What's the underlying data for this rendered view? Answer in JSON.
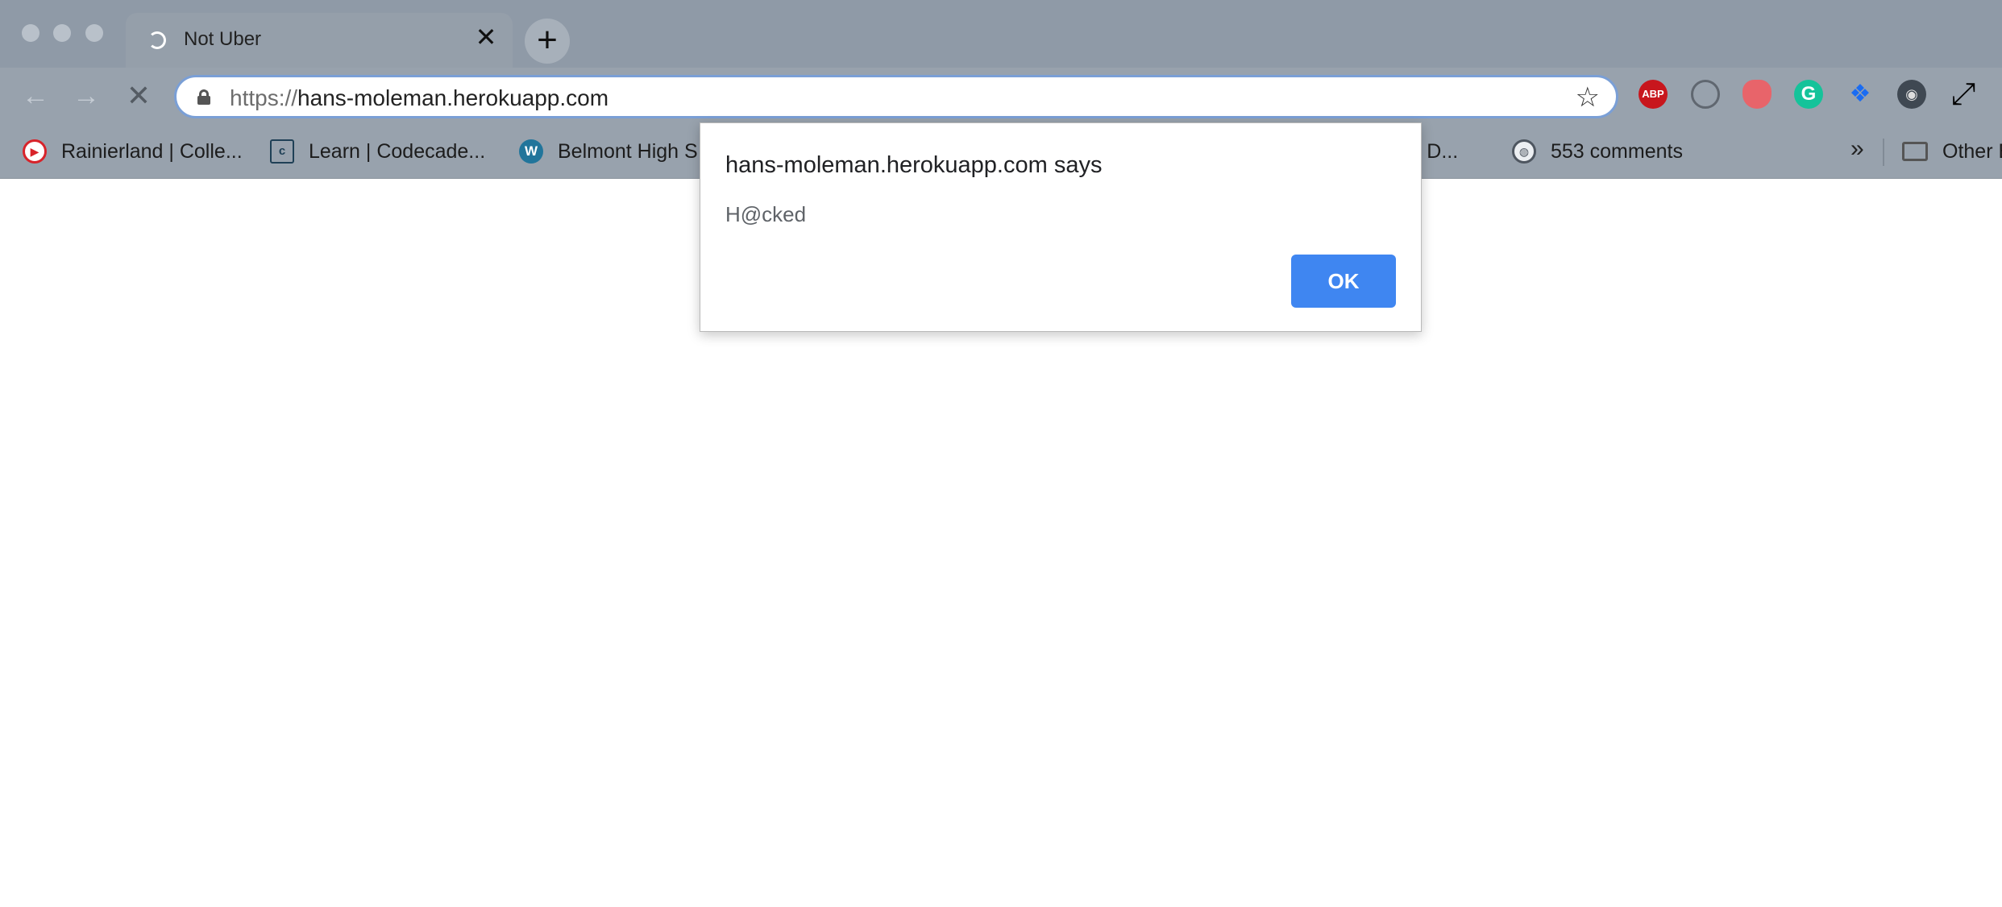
{
  "tab": {
    "title": "Not Uber",
    "close_glyph": "✕"
  },
  "new_tab_glyph": "+",
  "toolbar": {
    "back_glyph": "←",
    "forward_glyph": "→",
    "stop_glyph": "✕",
    "url_scheme": "https://",
    "url_host": "hans-moleman.herokuapp.com",
    "star_glyph": "☆",
    "extensions": [
      {
        "name": "adblock-plus-icon",
        "label": "ABP"
      },
      {
        "name": "lightbulb-extension-icon",
        "label": ""
      },
      {
        "name": "shield-extension-icon",
        "label": ""
      },
      {
        "name": "grammarly-icon",
        "label": "G"
      },
      {
        "name": "dropbox-icon",
        "label": "❖"
      },
      {
        "name": "mask-extension-icon",
        "label": "◉"
      },
      {
        "name": "expand-icon",
        "label": "⤢"
      }
    ]
  },
  "bookmarks": {
    "items": [
      {
        "label": "Rainierland | Colle...",
        "icon": "youtube-play-icon",
        "glyph": "▶"
      },
      {
        "label": "Learn | Codecade...",
        "icon": "codecademy-icon",
        "glyph": "c"
      },
      {
        "label": "Belmont High S",
        "icon": "wordpress-icon",
        "glyph": "W"
      },
      {
        "label": "gle D...",
        "icon": "",
        "glyph": ""
      },
      {
        "label": "553 comments",
        "icon": "globe-icon",
        "glyph": "◍"
      }
    ],
    "more_glyph": "»",
    "other_label": "Other B"
  },
  "dialog": {
    "title": "hans-moleman.herokuapp.com says",
    "message": "H@cked",
    "ok_label": "OK"
  },
  "colors": {
    "tabstrip": "#8f9aa7",
    "toolbar": "#98a2ad",
    "ok_button": "#3f86f1"
  }
}
